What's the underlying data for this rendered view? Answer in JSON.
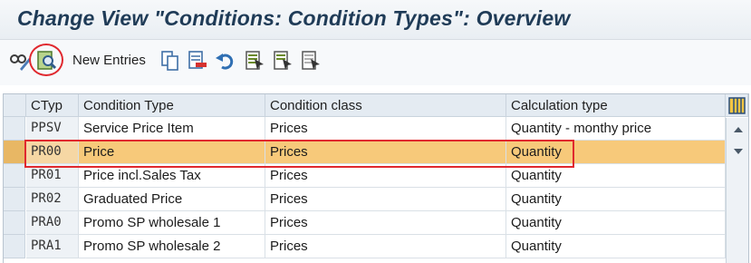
{
  "window": {
    "title": "Change View \"Conditions: Condition Types\": Overview"
  },
  "toolbar": {
    "new_entries_label": "New Entries",
    "icons": [
      "glasses-edit-icon",
      "details-icon",
      "copy-icon",
      "delete-icon",
      "undo-icon",
      "select-all-icon",
      "select-block-icon",
      "deselect-all-icon"
    ]
  },
  "table": {
    "headers": [
      "CTyp",
      "Condition Type",
      "Condition class",
      "Calculation type"
    ],
    "rows": [
      {
        "ctyp": "PPSV",
        "type": "Service Price Item",
        "class": "Prices",
        "calc": "Quantity - monthy price",
        "selected": false
      },
      {
        "ctyp": "PR00",
        "type": "Price",
        "class": "Prices",
        "calc": "Quantity",
        "selected": true
      },
      {
        "ctyp": "PR01",
        "type": "Price incl.Sales Tax",
        "class": "Prices",
        "calc": "Quantity",
        "selected": false
      },
      {
        "ctyp": "PR02",
        "type": "Graduated Price",
        "class": "Prices",
        "calc": "Quantity",
        "selected": false
      },
      {
        "ctyp": "PRA0",
        "type": "Promo SP wholesale 1",
        "class": "Prices",
        "calc": "Quantity",
        "selected": false
      },
      {
        "ctyp": "PRA1",
        "type": "Promo SP wholesale 2",
        "class": "Prices",
        "calc": "Quantity",
        "selected": false
      }
    ]
  },
  "colors": {
    "selected_row": "#f7c97a",
    "highlight": "#e0282e",
    "title": "#1f3b57"
  }
}
